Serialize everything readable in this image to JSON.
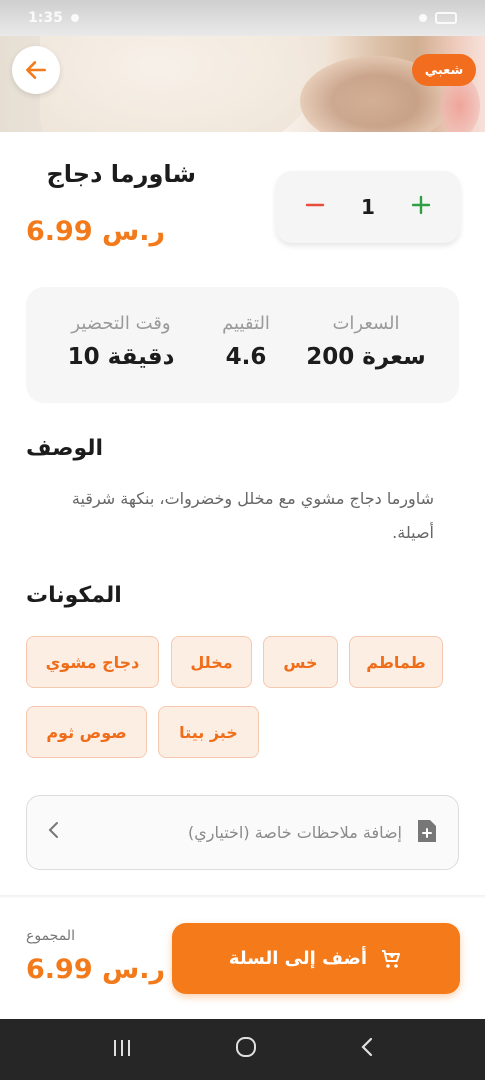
{
  "status_bar": {
    "time": "1:35"
  },
  "header": {
    "badge": "شعبي"
  },
  "product": {
    "name": "شاورما دجاج",
    "price": "6.99 ر.س",
    "quantity": "1"
  },
  "stats": {
    "calories_label": "السعرات",
    "calories_value": "200 سعرة",
    "rating_label": "التقييم",
    "rating_value": "4.6",
    "prep_label": "وقت التحضير",
    "prep_value": "10 دقيقة"
  },
  "description": {
    "title": "الوصف",
    "text": "شاورما دجاج مشوي مع مخلل وخضروات، بنكهة شرقية أصيلة."
  },
  "ingredients": {
    "title": "المكونات",
    "items": [
      "طماطم",
      "خس",
      "مخلل",
      "دجاج مشوي",
      "خبز بيتا",
      "صوص ثوم"
    ]
  },
  "notes": {
    "placeholder": "إضافة ملاحظات خاصة (اختياري)"
  },
  "footer": {
    "total_label": "المجموع",
    "total_value": "6.99 ر.س",
    "add_to_cart": "أضف إلى السلة"
  },
  "colors": {
    "accent": "#f47a1a",
    "chip_bg": "#fdeee4",
    "minus": "#e74c3c",
    "plus": "#2ea043"
  }
}
